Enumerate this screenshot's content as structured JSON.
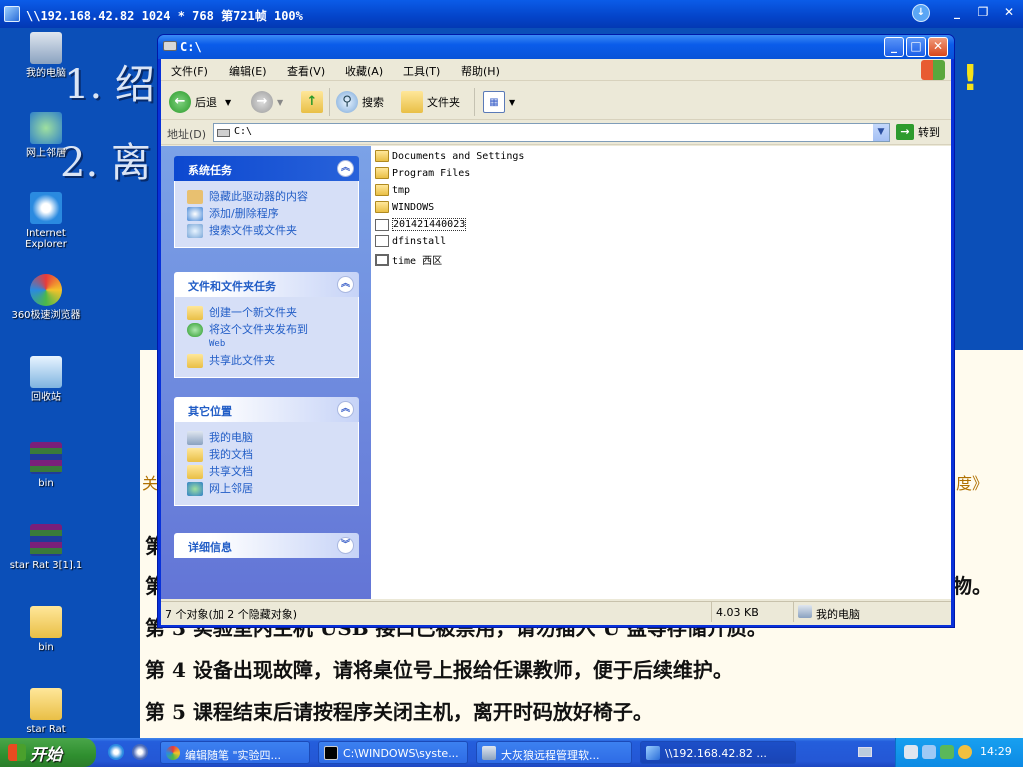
{
  "remote_title": "\\\\192.168.42.82 1024 * 768 第721帧 100%",
  "desktop": {
    "bg_line1": "1. 绍",
    "bg_line2": "2. 离",
    "bg_side_left": "关",
    "bg_side_right": "制度》",
    "bg_excl": "!",
    "doc_lines": [
      "第",
      "第",
      "第 3 实验室内主机 USB 接口已被禁用，请勿插入 U 盘等存储介质。",
      "第 4 设备出现故障，请将桌位号上报给任课教师，便于后续维护。",
      "第 5 课程结束后请按程序关闭主机，离开时码放好椅子。"
    ],
    "doc_line2_right": "物。",
    "icons": [
      {
        "label": "我的电脑"
      },
      {
        "label": "网上邻居"
      },
      {
        "label": "Internet Explorer"
      },
      {
        "label": "360极速浏览器"
      },
      {
        "label": "回收站"
      },
      {
        "label": "bin"
      },
      {
        "label": "star Rat 3[1].1"
      },
      {
        "label": "bin"
      },
      {
        "label": "star Rat"
      }
    ]
  },
  "explorer": {
    "title": "C:\\",
    "menu": [
      "文件(F)",
      "编辑(E)",
      "查看(V)",
      "收藏(A)",
      "工具(T)",
      "帮助(H)"
    ],
    "toolbar": {
      "back": "后退",
      "search": "搜索",
      "folders": "文件夹"
    },
    "address_label": "地址(D)",
    "address_value": "C:\\",
    "go_label": "转到",
    "panels": [
      {
        "title": "系统任务",
        "items": [
          "隐藏此驱动器的内容",
          "添加/删除程序",
          "搜索文件或文件夹"
        ]
      },
      {
        "title": "文件和文件夹任务",
        "items": [
          "创建一个新文件夹",
          "将这个文件夹发布到",
          "共享此文件夹"
        ],
        "item2_sub": "Web"
      },
      {
        "title": "其它位置",
        "items": [
          "我的电脑",
          "我的文档",
          "共享文档",
          "网上邻居"
        ]
      },
      {
        "title": "详细信息",
        "items": []
      }
    ],
    "files": [
      {
        "name": "Documents and Settings",
        "type": "folder"
      },
      {
        "name": "Program Files",
        "type": "folder"
      },
      {
        "name": "tmp",
        "type": "folder"
      },
      {
        "name": "WINDOWS",
        "type": "folder"
      },
      {
        "name": "201421440023",
        "type": "doc"
      },
      {
        "name": "dfinstall",
        "type": "doc"
      },
      {
        "name": "time 西区",
        "type": "shortcut"
      }
    ],
    "status": {
      "count": "7 个对象(加 2 个隐藏对象)",
      "size": "4.03 KB",
      "location": "我的电脑"
    }
  },
  "taskbar": {
    "start": "开始",
    "tasks": [
      "编辑随笔 \"实验四...",
      "C:\\WINDOWS\\syste...",
      "大灰狼远程管理软...",
      "\\\\192.168.42.82 ..."
    ],
    "clock": "14:29"
  }
}
